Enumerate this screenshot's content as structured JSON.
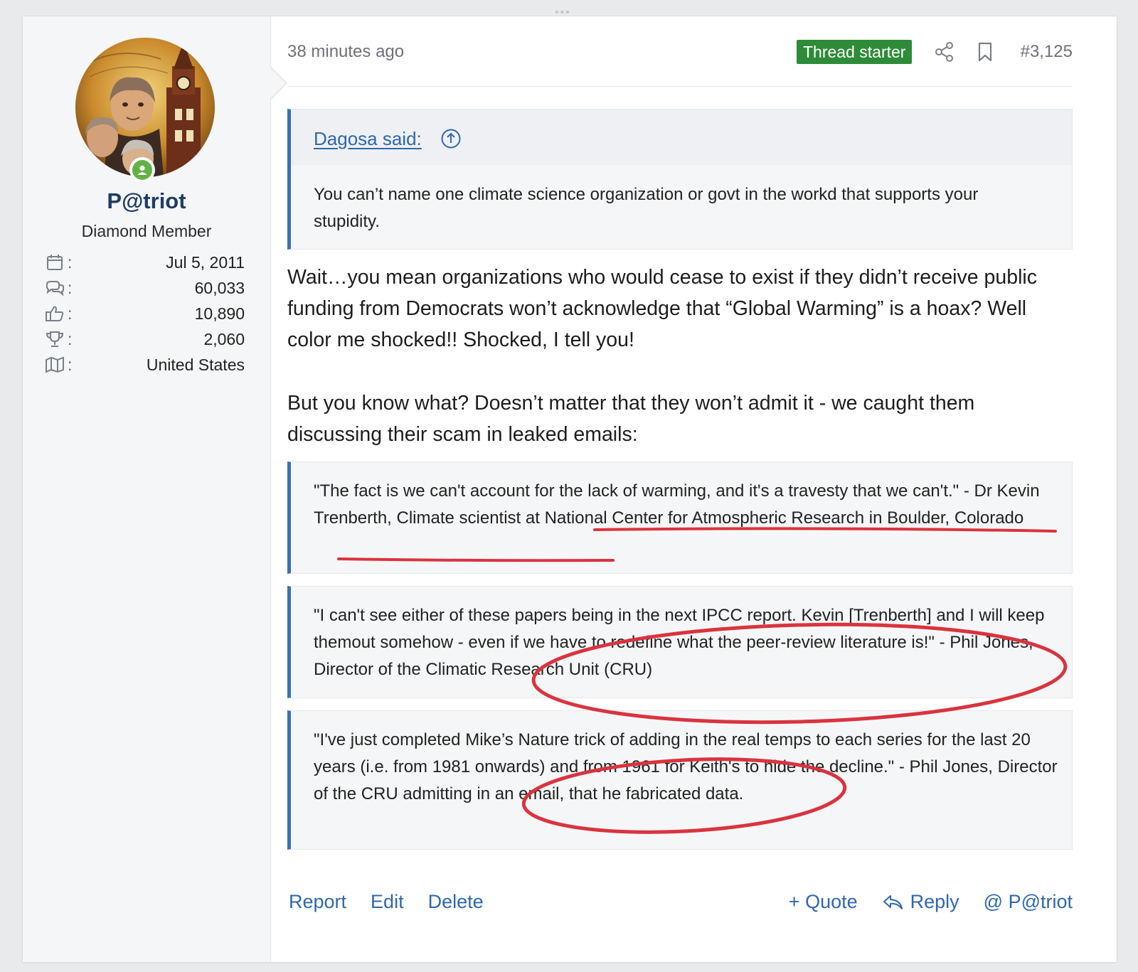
{
  "topbar": {
    "dots": "•••"
  },
  "user": {
    "name": "P@triot",
    "title": "Diamond Member",
    "stats": [
      {
        "icon": "calendar-icon",
        "value": "Jul 5, 2011"
      },
      {
        "icon": "messages-icon",
        "value": "60,033"
      },
      {
        "icon": "thumbs-up-icon",
        "value": "10,890"
      },
      {
        "icon": "trophy-icon",
        "value": "2,060"
      },
      {
        "icon": "map-icon",
        "value": "United States"
      }
    ],
    "stat_colon": ":"
  },
  "post": {
    "time": "38 minutes ago",
    "badge": "Thread starter",
    "number": "#3,125",
    "quote": {
      "author": "Dagosa said:",
      "text": "You can’t name one climate science organization or govt in the workd that supports your stupidity."
    },
    "paragraphs": [
      "Wait…you mean organizations who would cease to exist if they didn’t receive public funding from Democrats won’t acknowledge that “Global Warming” is a hoax? Well color me shocked!! Shocked, I tell you!",
      "But you know what? Doesn’t matter that they won’t admit it - we caught them discussing their scam in leaked emails:"
    ],
    "blockquotes": [
      "\"The fact is we can't account for the lack of warming, and it's a travesty that we can't.\" - Dr Kevin Trenberth, Climate scientist at National Center for Atmospheric Research in Boulder, Colorado",
      "\"I can't see either of these papers being in the next IPCC report. Kevin [Trenberth] and I will keep themout somehow - even if we have to redefine what the peer-review literature is!\" - Phil Jones, Director of the Climatic Research Unit (CRU)",
      "\"I've just completed Mike’s Nature trick of adding in the real temps to each series for the last 20 years (i.e. from 1981 onwards) and from 1961 for Keith's to hide the decline.\" - Phil Jones, Director of the CRU admitting in an email, that he fabricated data."
    ]
  },
  "actions": {
    "report": "Report",
    "edit": "Edit",
    "delete": "Delete",
    "quote": "+ Quote",
    "reply": "Reply",
    "mention": "@ P@triot"
  },
  "colors": {
    "accent": "#2f67ad",
    "badge": "#2e8b38",
    "quote_border": "#3a6fb5",
    "annotation": "#d9343f",
    "online": "#63b246"
  }
}
